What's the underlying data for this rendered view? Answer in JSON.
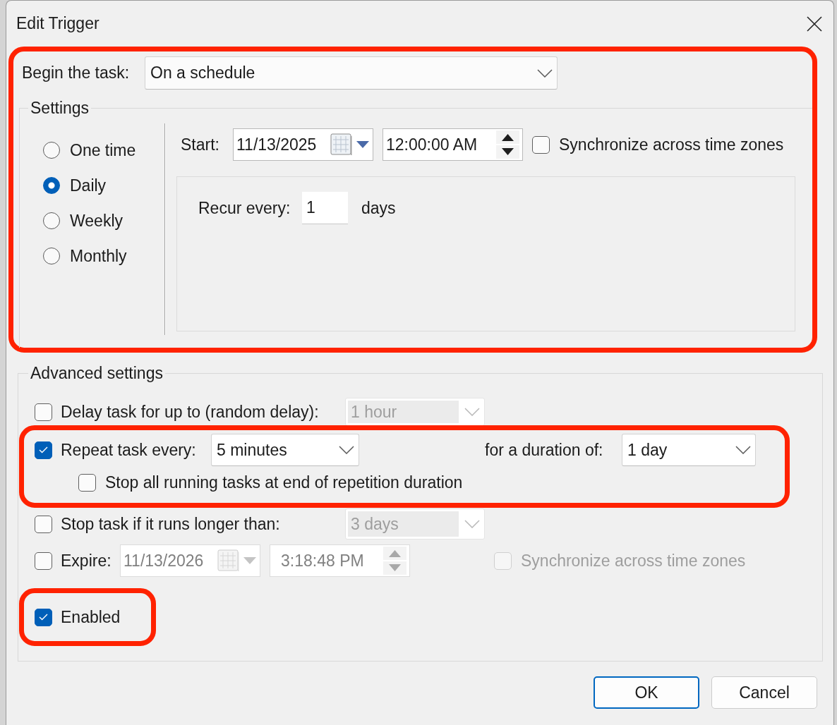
{
  "window": {
    "title": "Edit Trigger"
  },
  "schedule_section": {
    "highlighted": true,
    "begin_task": {
      "label": "Begin the task:",
      "value": "On a schedule"
    },
    "settings": {
      "title": "Settings",
      "frequency_options": [
        {
          "label": "One time",
          "selected": false
        },
        {
          "label": "Daily",
          "selected": true
        },
        {
          "label": "Weekly",
          "selected": false
        },
        {
          "label": "Monthly",
          "selected": false
        }
      ],
      "start": {
        "label": "Start:",
        "date": "11/13/2025",
        "time": "12:00:00 AM"
      },
      "sync_time_zones": {
        "label": "Synchronize across time zones",
        "checked": false
      },
      "recur": {
        "label": "Recur every:",
        "value": "1",
        "unit": "days"
      }
    }
  },
  "advanced_settings": {
    "title": "Advanced settings",
    "delay": {
      "label": "Delay task for up to (random delay):",
      "checked": false,
      "value": "1 hour",
      "disabled": true
    },
    "repetition": {
      "highlighted": true,
      "repeat": {
        "label": "Repeat task every:",
        "checked": true,
        "value": "5 minutes"
      },
      "duration": {
        "label": "for a duration of:",
        "value": "1 day"
      },
      "stop_all": {
        "label": "Stop all running tasks at end of repetition duration",
        "checked": false
      }
    },
    "stop_if_longer": {
      "label": "Stop task if it runs longer than:",
      "checked": false,
      "value": "3 days",
      "disabled": true
    },
    "expire": {
      "label": "Expire:",
      "checked": false,
      "date": "11/13/2026",
      "time": "3:18:48 PM",
      "disabled": true,
      "sync_time_zones": {
        "label": "Synchronize across time zones",
        "checked": false,
        "disabled": true
      }
    },
    "enabled": {
      "label": "Enabled",
      "checked": true,
      "highlighted": true
    }
  },
  "buttons": [
    {
      "label": "OK",
      "default": true
    },
    {
      "label": "Cancel",
      "default": false
    }
  ]
}
